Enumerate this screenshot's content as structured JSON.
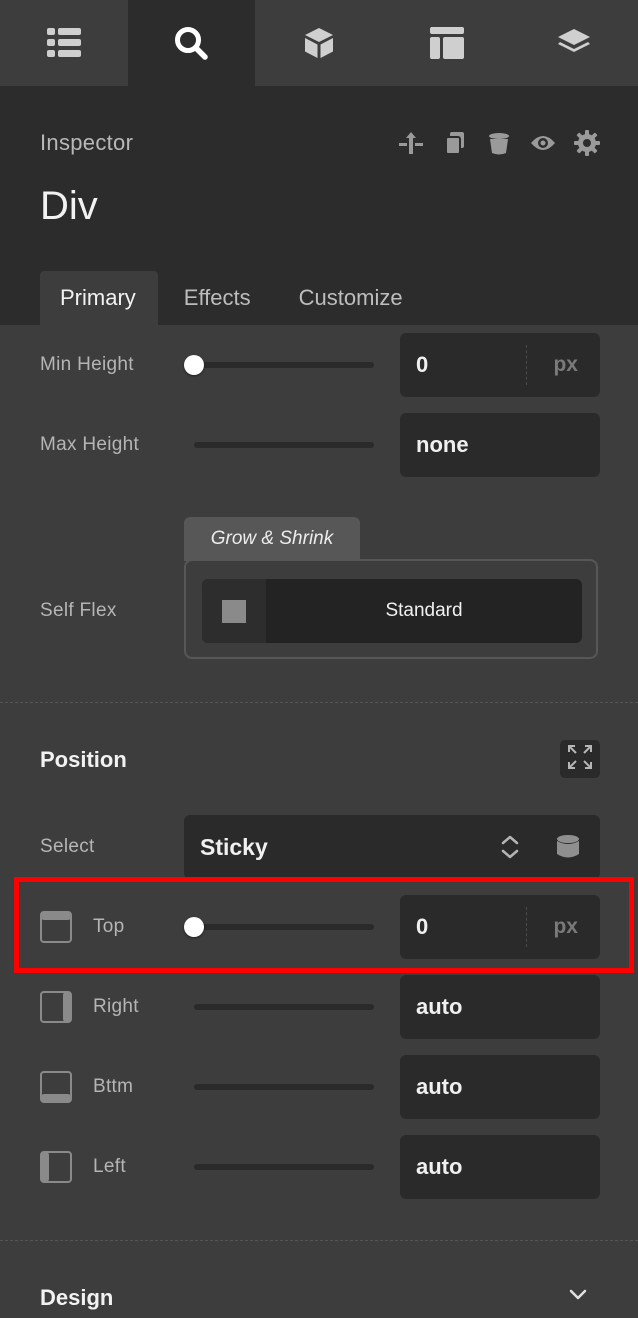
{
  "toolbar": {
    "tabs": [
      {
        "icon": "list-icon",
        "active": false
      },
      {
        "icon": "search-icon",
        "active": true
      },
      {
        "icon": "cube-icon",
        "active": false
      },
      {
        "icon": "layout-icon",
        "active": false
      },
      {
        "icon": "layers-icon",
        "active": false
      }
    ]
  },
  "inspector": {
    "label": "Inspector",
    "element": "Div",
    "actions": [
      "move-icon",
      "duplicate-icon",
      "delete-icon",
      "visibility-icon",
      "settings-icon"
    ],
    "tabs": [
      "Primary",
      "Effects",
      "Customize"
    ],
    "active_tab": "Primary"
  },
  "size": {
    "min_height": {
      "label": "Min Height",
      "value": "0",
      "unit": "px",
      "slider_fraction": 0
    },
    "max_height": {
      "label": "Max Height",
      "value": "none"
    },
    "self_flex": {
      "label": "Self Flex",
      "tab": "Grow & Shrink",
      "option": "Standard"
    }
  },
  "position": {
    "title": "Position",
    "select_label": "Select",
    "select_value": "Sticky",
    "top": {
      "label": "Top",
      "value": "0",
      "unit": "px",
      "slider_fraction": 0
    },
    "right": {
      "label": "Right",
      "value": "auto"
    },
    "bottom": {
      "label": "Bttm",
      "value": "auto"
    },
    "left": {
      "label": "Left",
      "value": "auto"
    }
  },
  "design": {
    "title": "Design"
  },
  "colors": {
    "highlight": "#ff0000",
    "panel": "#3d3d3d",
    "header": "#2c2c2c"
  }
}
